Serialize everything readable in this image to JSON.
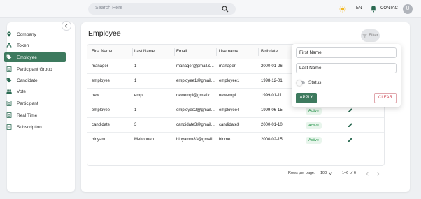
{
  "topbar": {
    "search_placeholder": "Search Here",
    "language": "EN",
    "contact": "CONTACT",
    "avatar_initial": "U"
  },
  "sidebar": {
    "items": [
      {
        "label": "Company",
        "icon": "location-pin-icon"
      },
      {
        "label": "Token",
        "icon": "sitemap-icon"
      },
      {
        "label": "Employee",
        "icon": "tag-icon"
      },
      {
        "label": "Participant Group",
        "icon": "document-icon"
      },
      {
        "label": "Candidate",
        "icon": "tag-icon"
      },
      {
        "label": "Vote",
        "icon": "people-icon"
      },
      {
        "label": "Participant",
        "icon": "document-icon"
      },
      {
        "label": "Real Time",
        "icon": "document-icon"
      },
      {
        "label": "Subscription",
        "icon": "document-icon"
      }
    ],
    "active_index": 2
  },
  "main": {
    "title": "Employee",
    "filter_label": "Filter"
  },
  "table": {
    "columns": [
      "First Name",
      "Last Name",
      "Email",
      "Username",
      "Birthdate"
    ],
    "rows": [
      {
        "first": "manager",
        "last": "1",
        "email": "manager@gmail.c...",
        "username": "manager",
        "birthdate": "2000-01-26",
        "status": ""
      },
      {
        "first": "employee",
        "last": "1",
        "email": "employee1@gmail...",
        "username": "employee1",
        "birthdate": "1998-12-01",
        "status": ""
      },
      {
        "first": "new",
        "last": "emp",
        "email": "newempl@gmail.c...",
        "username": "newempl",
        "birthdate": "1999-01-11",
        "status": ""
      },
      {
        "first": "employee",
        "last": "1",
        "email": "employee2@gmail...",
        "username": "employee4",
        "birthdate": "1999-06-15",
        "status": "Active"
      },
      {
        "first": "candidate",
        "last": "3",
        "email": "candidate3@gmail...",
        "username": "candidate3",
        "birthdate": "2000-01-10",
        "status": "Active"
      },
      {
        "first": "binyam",
        "last": "Mekonnen",
        "email": "binyamm83@gmail...",
        "username": "binme",
        "birthdate": "2000-02-15",
        "status": "Active"
      }
    ]
  },
  "pagination": {
    "rows_per_page_label": "Rows per page:",
    "rows_per_page_value": "100",
    "range": "1–6 of 6"
  },
  "filter_popup": {
    "first_name_placeholder": "First Name",
    "last_name_placeholder": "Last Name",
    "status_label": "Status",
    "apply_label": "APPLY",
    "clear_label": "CLEAR"
  },
  "colors": {
    "accent": "#3d7a5e",
    "active_badge_text": "#2f9a52",
    "clear_text": "#d04a57"
  }
}
